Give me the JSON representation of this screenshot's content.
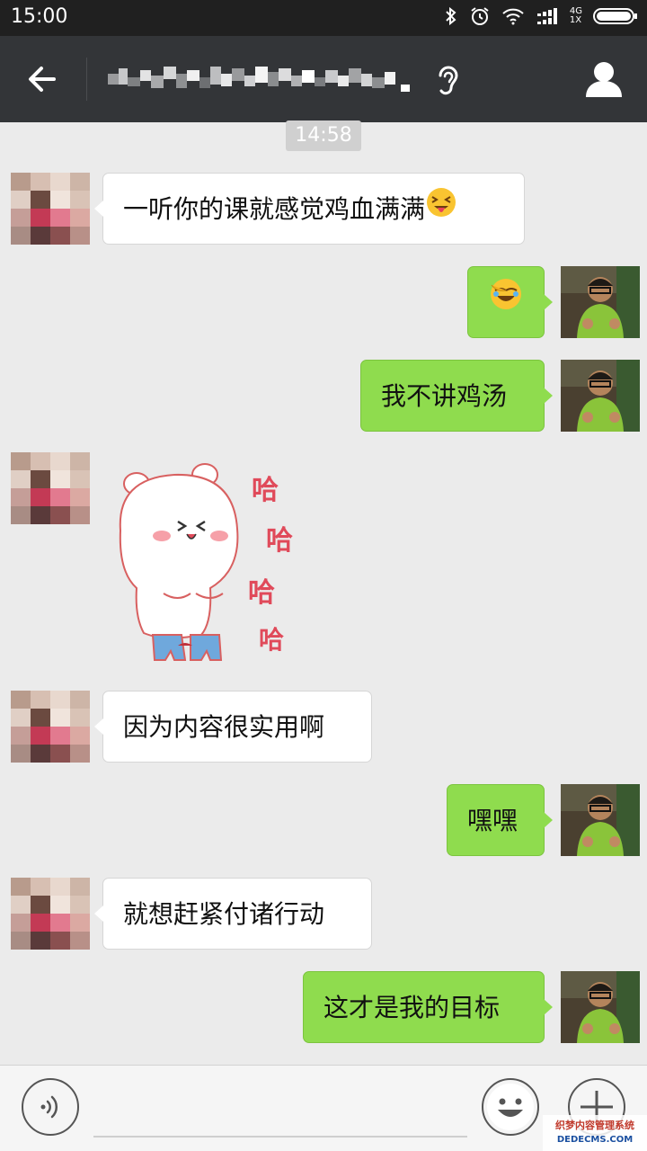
{
  "status_bar": {
    "time": "15:00",
    "network_top": "4G",
    "network_bottom": "1X",
    "icons": [
      "bluetooth-icon",
      "alarm-icon",
      "wifi-icon",
      "signal-icon",
      "battery-icon"
    ]
  },
  "nav": {
    "title_obscured": true,
    "icons": [
      "back-arrow-icon",
      "ear-icon",
      "profile-icon"
    ]
  },
  "chat": {
    "timestamp": "14:58",
    "messages": [
      {
        "side": "left",
        "type": "text",
        "text": "一听你的课就感觉鸡血满满",
        "emoji": "tongue-out-emoji"
      },
      {
        "side": "right",
        "type": "emoji",
        "emoji": "facepalm-laugh-emoji"
      },
      {
        "side": "right",
        "type": "text",
        "text": "我不讲鸡汤"
      },
      {
        "side": "left",
        "type": "sticker",
        "sticker": "laughing-bear-sticker",
        "sticker_text": [
          "哈",
          "哈",
          "哈",
          "哈"
        ]
      },
      {
        "side": "left",
        "type": "text",
        "text": "因为内容很实用啊"
      },
      {
        "side": "right",
        "type": "text",
        "text": "嘿嘿"
      },
      {
        "side": "left",
        "type": "text",
        "text": "就想赶紧付诸行动"
      },
      {
        "side": "right",
        "type": "text",
        "text": "这才是我的目标"
      }
    ]
  },
  "bottom_bar": {
    "icons": [
      "voice-icon",
      "sticker-icon",
      "plus-icon"
    ]
  },
  "watermark": {
    "line1": "织梦内容管理系统",
    "line2": "DEDECMS.COM"
  },
  "colors": {
    "status_bg": "#202020",
    "nav_bg": "#333538",
    "chat_bg": "#ebebeb",
    "bubble_right": "#8fdc4e",
    "bubble_left": "#ffffff"
  }
}
